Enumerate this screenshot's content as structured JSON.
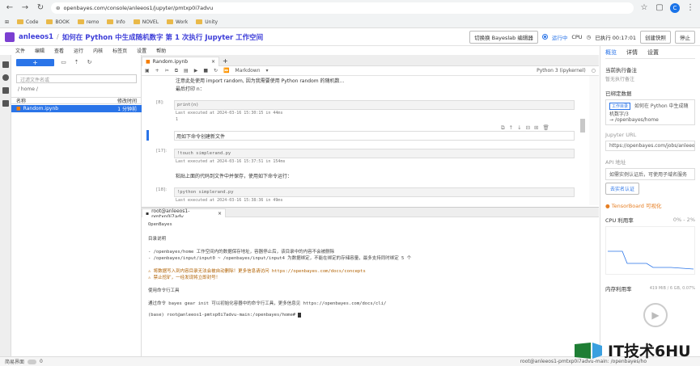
{
  "browser": {
    "url": "openbayes.com/console/anleeos1/jupyter/pmtxp0i7advu",
    "bookmarks": [
      "Code",
      "BOOK",
      "remo",
      "Info",
      "NOVEL",
      "Work",
      "Unity"
    ]
  },
  "header": {
    "owner": "anleeos1",
    "sep": "/",
    "title": "如何在 Python 中生成随机数字 第 1 次执行 Jupyter 工作空间",
    "switch_btn": "切换换 Bayeslab 编辑器",
    "status": "运行中",
    "cpu": "CPU",
    "run_time": "已执行 00:17:01",
    "snapshot_btn": "创建快照",
    "stop_btn": "停止"
  },
  "jmenu": [
    "文件",
    "编辑",
    "查看",
    "运行",
    "内核",
    "标签页",
    "设置",
    "帮助"
  ],
  "filebrowser": {
    "new_label": "+",
    "search_placeholder": "过滤文件名或",
    "path": "/ home /",
    "col_name": "名称",
    "col_modified": "修改时间",
    "file_name": "Random.ipynb",
    "file_time": "1 分钟前"
  },
  "notebook": {
    "tab_label": "Random.ipynb",
    "cell_type": "Markdown",
    "kernel": "Python 3 (ipykernel)",
    "top_text": "注意此处使用 import random, 因为我需要使用 Python random 的随机数...",
    "top_text2": "最后打印 n：",
    "cells": [
      {
        "prompt": "[8]:",
        "code": "print(n)",
        "meta": "Last executed at 2024-03-16 15:30:15 in 44ms",
        "output": "1"
      },
      {
        "md": "用如下命令创建新文件"
      },
      {
        "prompt": "[17]:",
        "code": "!touch simplerand.py",
        "meta": "Last executed at 2024-03-16 15:37:51 in 154ms"
      },
      {
        "md": "粘贴上面的代码到文件中并保存，使用如下命令运行："
      },
      {
        "prompt": "[18]:",
        "code": "!python simplerand.py",
        "meta": "Last executed at 2024-03-16 15:38:36 in 49ms"
      }
    ],
    "cell_tools": [
      "⧉",
      "↑",
      "↓",
      "⊟",
      "⊞",
      "🗑"
    ]
  },
  "terminal": {
    "tab_label": "root@anleeos1-pmtxp0i7adv",
    "lines": [
      "OpenBayes",
      "",
      "目录说明",
      "",
      "- /openbayes/home 工作空间内的数据保存地址，容器停止后，该目录中的内容不会被删除",
      "- /openbayes/input/input0 ~ /openbayes/input/input4 为数据绑定，不能在绑定的存储容量，最多支持同时绑定 5 个",
      "",
      "⚠ 将数据写入到内容目录无法会被自动删除！更多信息请访问 https://openbayes.com/docs/concepts",
      "⚠ 禁止挖矿，一经发现将立即封号！",
      "",
      "使用命令行工具",
      "",
      "通过命令 bayes gear init 可以初始化容器中的命令行工具，更多信息见 https://openbayes.com/docs/cli/",
      "",
      "(base) root@anleeos1-pmtxp0i7advu-main:/openbayes/home#"
    ]
  },
  "right": {
    "tabs": [
      "概览",
      "详情",
      "设置"
    ],
    "exec_note_label": "当前执行备注",
    "exec_note_val": "暂无执行备注",
    "bound_label": "已绑定数据",
    "bound_tag": "工作目录",
    "bound_name": "如何在 Python 中生成随机数字/3",
    "bound_path": "→ /openbayes/home",
    "jupyter_url_label": "Jupyter URL",
    "jupyter_url": "https://openbayes.com/jobs/anleeo",
    "api_label": "API 地址",
    "api_val": "如需实例认证后，可使用子域名服务",
    "api_btn": "去实名认证",
    "tensorboard": "TensorBoard 可视化",
    "cpu_label": "CPU 利用率",
    "cpu_range": "0% - 2%",
    "mem_label": "内存利用率",
    "mem_val": "419 MiB / 6 GB, 0.07%"
  },
  "status": {
    "simple": "简易界面",
    "count": "0",
    "right": "root@anleeos1-pmtxp0i7advu-main: /openbayes/ho"
  },
  "watermark": "IT技术6HU"
}
